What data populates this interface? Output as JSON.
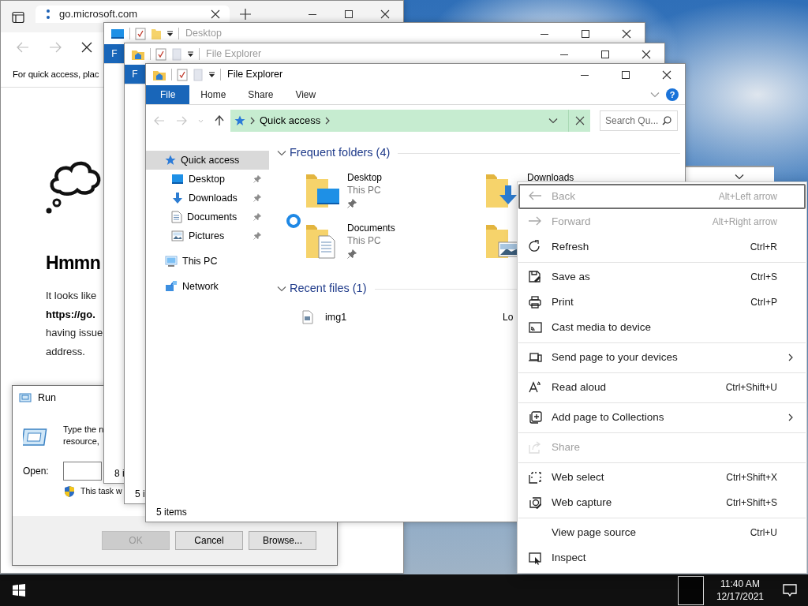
{
  "browser": {
    "tab_title": "go.microsoft.com",
    "favorites_hint": "For quick access, plac",
    "heading": "Hmmn",
    "body_lines": [
      {
        "text": "It looks like",
        "bold": false
      },
      {
        "text": "https://go.",
        "bold": true
      },
      {
        "text": "having issue",
        "bold": false
      },
      {
        "text": "address.",
        "bold": false
      }
    ]
  },
  "explorer_back": {
    "title": "Desktop",
    "ribbon_tabs": [
      {
        "label": "F",
        "kind": "file_menu"
      }
    ],
    "status": "8 i"
  },
  "explorer_middle": {
    "title": "File Explorer",
    "ribbon_tabs": [
      {
        "label": "F",
        "kind": "file_menu"
      }
    ],
    "status": "5 i"
  },
  "explorer": {
    "title": "File Explorer",
    "ribbon_tabs": [
      {
        "label": "File",
        "kind": "file_menu"
      },
      {
        "label": "Home",
        "kind": "tab"
      },
      {
        "label": "Share",
        "kind": "tab"
      },
      {
        "label": "View",
        "kind": "tab"
      }
    ],
    "help_glyph": "?",
    "address": "Quick access",
    "search": {
      "placeholder": "Search Qu..."
    },
    "nav": [
      {
        "label": "Quick access",
        "selected": true,
        "children": [
          {
            "label": "Desktop",
            "selected": false,
            "pinned": true
          },
          {
            "label": "Downloads",
            "selected": false,
            "pinned": true
          },
          {
            "label": "Documents",
            "selected": false,
            "pinned": true
          },
          {
            "label": "Pictures",
            "selected": false,
            "pinned": true
          }
        ]
      },
      {
        "label": "This PC",
        "selected": false
      },
      {
        "label": "Network",
        "selected": false
      }
    ],
    "frequent_header": "Frequent folders (4)",
    "folders": [
      {
        "name": "Desktop",
        "location": "This PC",
        "pinned": true
      },
      {
        "name": "Downloads",
        "pinned": false
      },
      {
        "name": "Documents",
        "location": "This PC",
        "pinned": true
      },
      {
        "pinned": false
      }
    ],
    "recent_header": "Recent files (1)",
    "recent_files": [
      {
        "name": "img1",
        "location": "Lo"
      }
    ],
    "status": "5 items"
  },
  "run": {
    "title": "Run",
    "lines": [
      "Type the n",
      "resource,"
    ],
    "open_label": "Open:",
    "elevation_note": "This task w",
    "buttons": [
      {
        "label": "OK",
        "disabled": true
      },
      {
        "label": "Cancel",
        "disabled": false
      },
      {
        "label": "Browse...",
        "disabled": false
      }
    ]
  },
  "context_menu": {
    "groups": [
      [
        {
          "label": "Back",
          "shortcut": "Alt+Left arrow",
          "disabled": true,
          "focused": true
        },
        {
          "label": "Forward",
          "shortcut": "Alt+Right arrow",
          "disabled": true,
          "focused": false
        },
        {
          "label": "Refresh",
          "shortcut": "Ctrl+R",
          "disabled": false,
          "focused": false
        }
      ],
      [
        {
          "label": "Save as",
          "shortcut": "Ctrl+S",
          "disabled": false,
          "focused": false
        },
        {
          "label": "Print",
          "shortcut": "Ctrl+P",
          "disabled": false,
          "focused": false
        },
        {
          "label": "Cast media to device",
          "disabled": false,
          "focused": false
        }
      ],
      [
        {
          "label": "Send page to your devices",
          "submenu": true,
          "disabled": false,
          "focused": false
        }
      ],
      [
        {
          "label": "Read aloud",
          "shortcut": "Ctrl+Shift+U",
          "disabled": false,
          "focused": false
        }
      ],
      [
        {
          "label": "Add page to Collections",
          "submenu": true,
          "disabled": false,
          "focused": false
        }
      ],
      [
        {
          "label": "Share",
          "disabled": true,
          "focused": false
        }
      ],
      [
        {
          "label": "Web select",
          "shortcut": "Ctrl+Shift+X",
          "disabled": false,
          "focused": false
        },
        {
          "label": "Web capture",
          "shortcut": "Ctrl+Shift+S",
          "disabled": false,
          "focused": false
        }
      ],
      [
        {
          "label": "View page source",
          "shortcut": "Ctrl+U",
          "disabled": false,
          "focused": false
        },
        {
          "label": "Inspect",
          "disabled": false,
          "focused": false
        }
      ]
    ]
  },
  "taskbar": {
    "time": "11:40 AM",
    "date": "12/17/2021"
  }
}
